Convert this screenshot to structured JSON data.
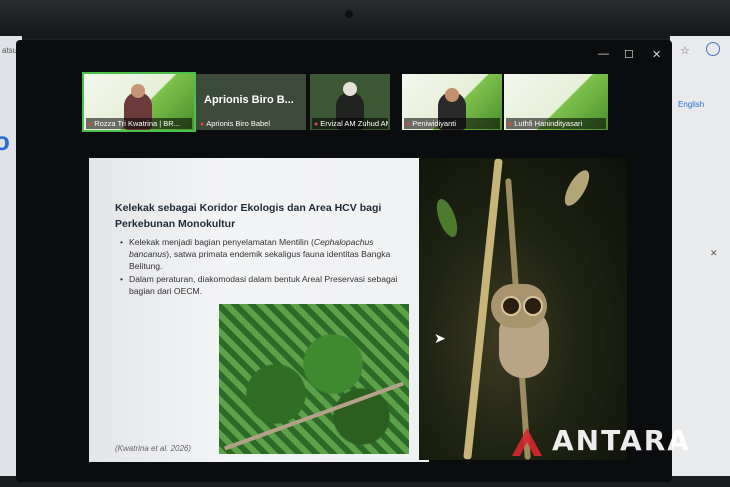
{
  "meeting": {
    "title_tile": "Aprionis Biro B...",
    "participants": [
      {
        "name": "Rozza Tri Kwatrina | BR...",
        "muted": true,
        "active": true
      },
      {
        "name": "Aprionis Biro Babel",
        "muted": true
      },
      {
        "name": "Ervizal AM Zuhud AM...",
        "muted": true
      },
      {
        "name": "Peniwidiyanti",
        "muted": true
      },
      {
        "name": "Luthfi Hanindityasari",
        "muted": true
      }
    ],
    "window_controls": {
      "minimize": "—",
      "maximize": "☐",
      "close": "✕"
    }
  },
  "slide": {
    "title_line1": "Kelekak sebagai Koridor Ekologis dan Area HCV bagi",
    "title_line2": "Perkebunan Monokultur",
    "bullet1_a": "Kelekak menjadi bagian penyelamatan Mentilin (",
    "bullet1_italic": "Cephalopachus bancanus",
    "bullet1_b": "), satwa primata endemik sekaligus fauna identitas Bangka Belitung.",
    "bullet2": "Dalam peraturan, diakomodasi dalam bentuk Areal Preservasi sebagai bagian dari OECM.",
    "citation": "(Kwatrina et al. 2026)"
  },
  "background_browser": {
    "left_text": "atsu",
    "right_text": "English"
  },
  "watermark": {
    "text": "ANTARA",
    "accent": "#d8262f"
  },
  "colors": {
    "active_speaker": "#49c24c",
    "muted_mic": "#e04646"
  }
}
